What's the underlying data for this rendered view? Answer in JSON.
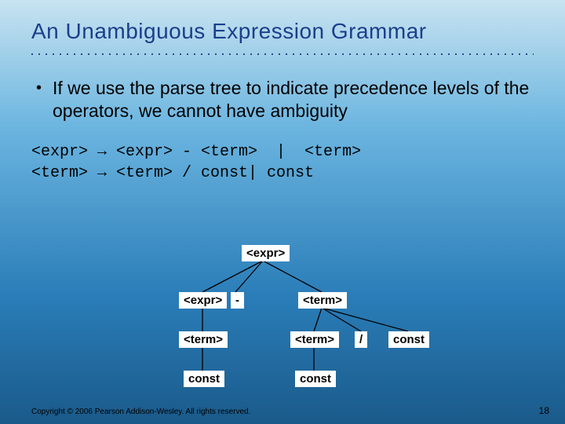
{
  "title": "An Unambiguous Expression Grammar",
  "bullet": {
    "dot": "•",
    "text": "If we use the parse tree to indicate precedence levels of the operators, we cannot have ambiguity"
  },
  "grammar": {
    "line1": "<expr> → <expr> - <term>  |  <term>",
    "line2": "<term> → <term> / const| const"
  },
  "tree": {
    "n_expr_root": "<expr>",
    "n_expr_l": "<expr>",
    "n_minus": "-",
    "n_term_r": "<term>",
    "n_term_l": "<term>",
    "n_term_rl": "<term>",
    "n_slash": "/",
    "n_const_rr": "const",
    "n_const_l": "const",
    "n_const_rl": "const"
  },
  "footer": "Copyright © 2006 Pearson Addison-Wesley. All rights reserved.",
  "pagenum": "18",
  "chart_data": {
    "type": "tree",
    "root": "<expr>",
    "edges": [
      [
        "<expr>(root)",
        "<expr>(L)"
      ],
      [
        "<expr>(root)",
        "-"
      ],
      [
        "<expr>(root)",
        "<term>(R)"
      ],
      [
        "<expr>(L)",
        "<term>(L)"
      ],
      [
        "<term>(L)",
        "const(L)"
      ],
      [
        "<term>(R)",
        "<term>(RL)"
      ],
      [
        "<term>(R)",
        "/"
      ],
      [
        "<term>(R)",
        "const(RR)"
      ],
      [
        "<term>(RL)",
        "const(RL)"
      ]
    ]
  }
}
